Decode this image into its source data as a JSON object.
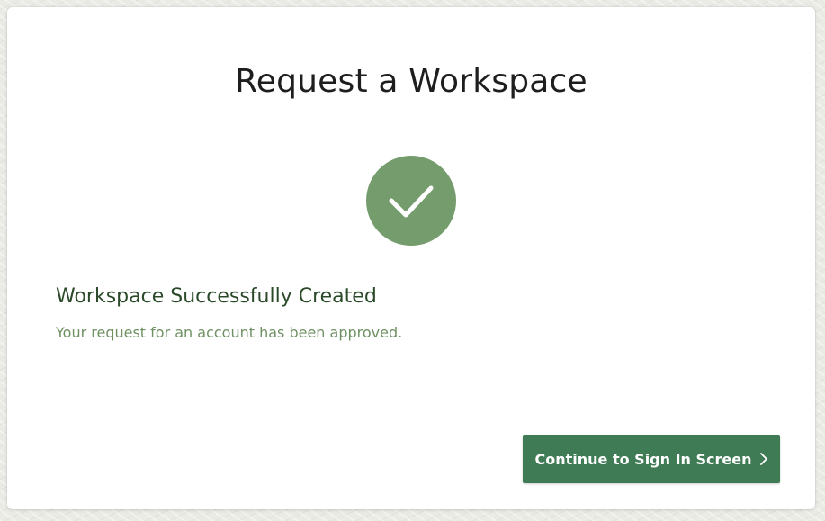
{
  "page": {
    "title": "Request a Workspace"
  },
  "status": {
    "icon": "checkmark-icon",
    "accent_color": "#759c6c",
    "headline": "Workspace Successfully Created",
    "message": "Your request for an account has been approved."
  },
  "actions": {
    "continue_label": "Continue to Sign In Screen",
    "continue_icon": "chevron-right-icon",
    "button_color": "#3f7b54"
  }
}
